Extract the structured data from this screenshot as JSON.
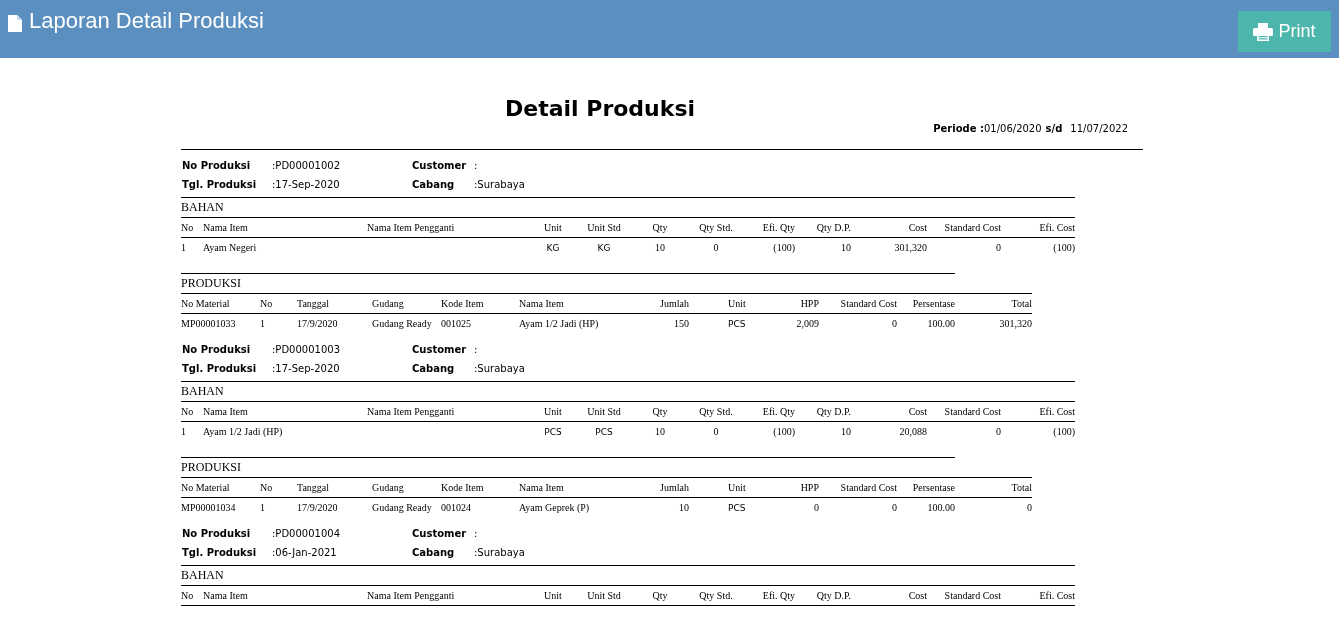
{
  "header": {
    "title": "Laporan Detail Produksi",
    "print_button": "Print"
  },
  "report": {
    "title": "Detail Produksi",
    "period_label": "Periode :",
    "period_from": "01/06/2020",
    "period_sep": "s/d",
    "period_to": "11/07/2022",
    "productions": [
      {
        "no_label": "No Produksi",
        "no": ":PD00001002",
        "date_label": "Tgl. Produksi",
        "date": ":17-Sep-2020",
        "customer_label": "Customer",
        "customer": ":",
        "branch_label": "Cabang",
        "branch": ":Surabaya",
        "bahan_title": "BAHAN",
        "bahan_columns": [
          "No",
          "Nama Item",
          "Nama Item Pengganti",
          "Unit",
          "Unit Std",
          "Qty",
          "Qty Std.",
          "Efi. Qty",
          "Qty D.P.",
          "Cost",
          "Standard Cost",
          "Efi. Cost"
        ],
        "bahan_rows": [
          [
            "1",
            "Ayam Negeri",
            "",
            "KG",
            "KG",
            "10",
            "0",
            "(100)",
            "10",
            "301,320",
            "0",
            "(100)"
          ]
        ],
        "produksi_title": "PRODUKSI",
        "produksi_columns": [
          "No Material",
          "No",
          "Tanggal",
          "Gudang",
          "Kode Item",
          "Nama Item",
          "Jumlah",
          "Unit",
          "HPP",
          "Standard Cost",
          "Persentase",
          "Total"
        ],
        "produksi_rows": [
          [
            "MP00001033",
            "1",
            "17/9/2020",
            "Gudang Ready",
            "001025",
            "Ayam 1/2 Jadi (HP)",
            "150",
            "PCS",
            "2,009",
            "0",
            "100.00",
            "301,320"
          ]
        ]
      },
      {
        "no_label": "No Produksi",
        "no": ":PD00001003",
        "date_label": "Tgl. Produksi",
        "date": ":17-Sep-2020",
        "customer_label": "Customer",
        "customer": ":",
        "branch_label": "Cabang",
        "branch": ":Surabaya",
        "bahan_title": "BAHAN",
        "bahan_columns": [
          "No",
          "Nama Item",
          "Nama Item Pengganti",
          "Unit",
          "Unit Std",
          "Qty",
          "Qty Std.",
          "Efi. Qty",
          "Qty D.P.",
          "Cost",
          "Standard Cost",
          "Efi. Cost"
        ],
        "bahan_rows": [
          [
            "1",
            "Ayam 1/2 Jadi (HP)",
            "",
            "PCS",
            "PCS",
            "10",
            "0",
            "(100)",
            "10",
            "20,088",
            "0",
            "(100)"
          ]
        ],
        "produksi_title": "PRODUKSI",
        "produksi_columns": [
          "No Material",
          "No",
          "Tanggal",
          "Gudang",
          "Kode Item",
          "Nama Item",
          "Jumlah",
          "Unit",
          "HPP",
          "Standard Cost",
          "Persentase",
          "Total"
        ],
        "produksi_rows": [
          [
            "MP00001034",
            "1",
            "17/9/2020",
            "Gudang Ready",
            "001024",
            "Ayam Geprek (P)",
            "10",
            "PCS",
            "0",
            "0",
            "100.00",
            "0"
          ]
        ]
      },
      {
        "no_label": "No Produksi",
        "no": ":PD00001004",
        "date_label": "Tgl. Produksi",
        "date": ":06-Jan-2021",
        "customer_label": "Customer",
        "customer": ":",
        "branch_label": "Cabang",
        "branch": ":Surabaya",
        "bahan_title": "BAHAN",
        "bahan_columns": [
          "No",
          "Nama Item",
          "Nama Item Pengganti",
          "Unit",
          "Unit Std",
          "Qty",
          "Qty Std.",
          "Efi. Qty",
          "Qty D.P.",
          "Cost",
          "Standard Cost",
          "Efi. Cost"
        ]
      }
    ]
  }
}
